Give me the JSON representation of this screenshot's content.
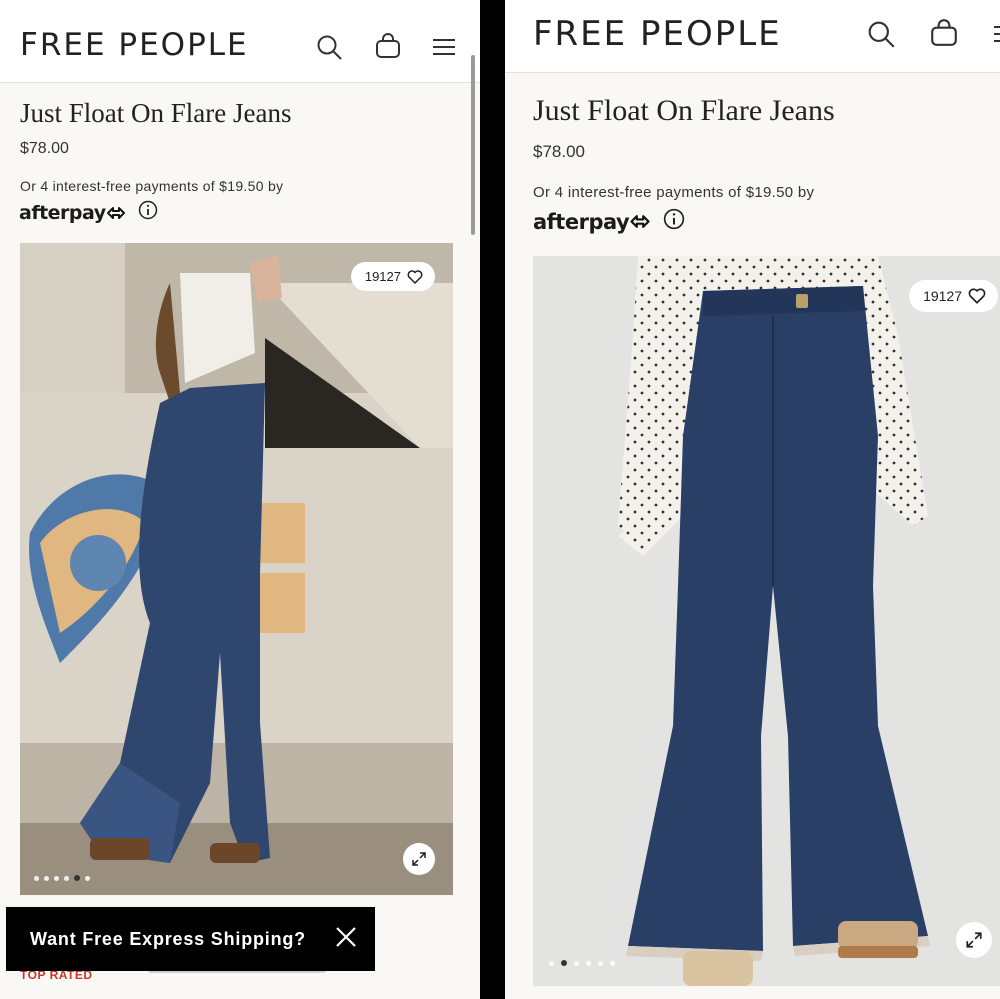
{
  "screens": [
    {
      "brand": "FREE PEOPLE",
      "product_title": "Just Float On Flare Jeans",
      "price": "$78.00",
      "payment_text": "Or 4 interest-free payments of $19.50 by",
      "afterpay_label": "afterpay",
      "like_count": "19127",
      "carousel": {
        "total": 6,
        "active": 5
      },
      "toast_text": "Want Free Express Shipping?",
      "top_rated": "Top Rated"
    },
    {
      "brand": "FREE PEOPLE",
      "product_title": "Just Float On Flare Jeans",
      "price": "$78.00",
      "payment_text": "Or 4 interest-free payments of $19.50 by",
      "afterpay_label": "afterpay",
      "like_count": "19127",
      "carousel": {
        "total": 6,
        "active": 2
      }
    }
  ],
  "icons": [
    "search-icon",
    "bag-icon",
    "menu-icon",
    "info-icon",
    "heart-icon",
    "expand-icon",
    "close-icon"
  ],
  "colors": {
    "denim": "#2a3f66",
    "toast_bg": "#000000",
    "page_bg": "#faf8f5"
  }
}
